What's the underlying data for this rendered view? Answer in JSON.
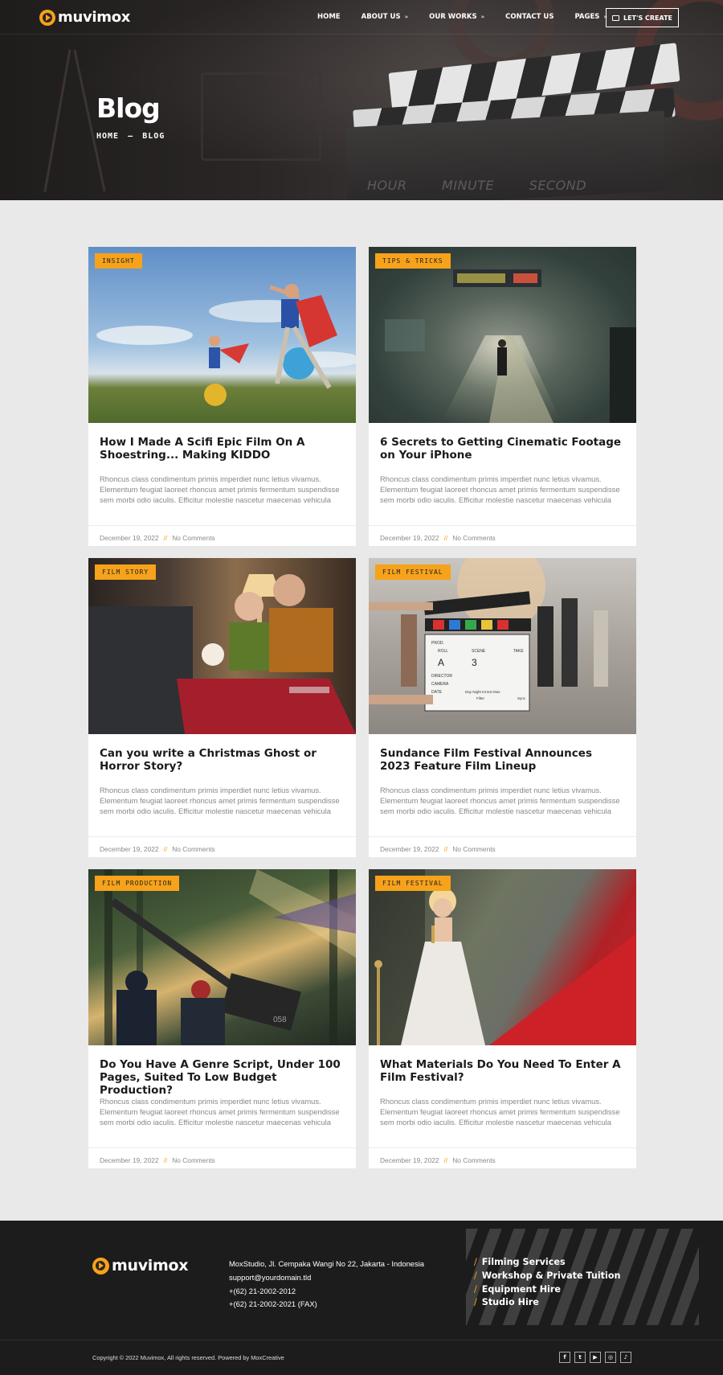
{
  "brand": {
    "name": "muvimox",
    "accent": "#f6a21b"
  },
  "nav": {
    "items": [
      {
        "label": "HOME",
        "has_dropdown": false
      },
      {
        "label": "ABOUT US",
        "has_dropdown": true
      },
      {
        "label": "OUR WORKS",
        "has_dropdown": true
      },
      {
        "label": "CONTACT US",
        "has_dropdown": false
      },
      {
        "label": "PAGES",
        "has_dropdown": true
      }
    ],
    "cta_label": "LET'S CREATE"
  },
  "hero": {
    "title": "Blog",
    "breadcrumb": [
      "HOME",
      "—",
      "BLOG"
    ],
    "slate_labels": [
      "HOUR",
      "MINUTE",
      "SECOND"
    ]
  },
  "posts": [
    {
      "tag": "INSIGHT",
      "title": "How I Made A Scifi Epic Film On A Shoestring... Making KIDDO",
      "excerpt": "Rhoncus class condimentum primis imperdiet nunc letius vivamus. Elementum feugiat laoreet rhoncus amet primis fermentum suspendisse sem morbi odio iaculis. Efficitur molestie nascetur maecenas vehicula",
      "date": "December 19, 2022",
      "comments": "No Comments",
      "sep": "//"
    },
    {
      "tag": "TIPS & TRICKS",
      "title": "6 Secrets to Getting Cinematic Footage on Your iPhone",
      "excerpt": "Rhoncus class condimentum primis imperdiet nunc letius vivamus. Elementum feugiat laoreet rhoncus amet primis fermentum suspendisse sem morbi odio iaculis. Efficitur molestie nascetur maecenas vehicula",
      "date": "December 19, 2022",
      "comments": "No Comments",
      "sep": "//"
    },
    {
      "tag": "FILM STORY",
      "title": "Can you write a Christmas Ghost or Horror Story?",
      "excerpt": "Rhoncus class condimentum primis imperdiet nunc letius vivamus. Elementum feugiat laoreet rhoncus amet primis fermentum suspendisse sem morbi odio iaculis. Efficitur molestie nascetur maecenas vehicula",
      "date": "December 19, 2022",
      "comments": "No Comments",
      "sep": "//"
    },
    {
      "tag": "FILM FESTIVAL",
      "title": "Sundance Film Festival Announces 2023 Feature Film Lineup",
      "excerpt": "Rhoncus class condimentum primis imperdiet nunc letius vivamus. Elementum feugiat laoreet rhoncus amet primis fermentum suspendisse sem morbi odio iaculis. Efficitur molestie nascetur maecenas vehicula",
      "date": "December 19, 2022",
      "comments": "No Comments",
      "sep": "//"
    },
    {
      "tag": "FILM PRODUCTION",
      "title": "Do You Have A Genre Script, Under 100 Pages, Suited To Low Budget Production?",
      "excerpt": "Rhoncus class condimentum primis imperdiet nunc letius vivamus. Elementum feugiat laoreet rhoncus amet primis fermentum suspendisse sem morbi odio iaculis. Efficitur molestie nascetur maecenas vehicula",
      "date": "December 19, 2022",
      "comments": "No Comments",
      "sep": "//"
    },
    {
      "tag": "FILM FESTIVAL",
      "title": "What Materials Do You Need To Enter A Film Festival?",
      "excerpt": "Rhoncus class condimentum primis imperdiet nunc letius vivamus. Elementum feugiat laoreet rhoncus amet primis fermentum suspendisse sem morbi odio iaculis. Efficitur molestie nascetur maecenas vehicula",
      "date": "December 19, 2022",
      "comments": "No Comments",
      "sep": "//"
    }
  ],
  "slate_card": {
    "prod": "PROD.",
    "roll": "ROLL",
    "scene": "SCENE",
    "take": "TAKE",
    "roll_val": "A",
    "scene_val": "3",
    "director": "DIRECTOR",
    "camera": "CAMERA",
    "date": "DATE",
    "day_night": "Day Night Int Ext Mos",
    "filter": "Filter",
    "sync": "Sync"
  },
  "train_number": "058",
  "footer": {
    "address": "MoxStudio, Jl. Cempaka Wangi No 22, Jakarta - Indonesia",
    "email": "support@yourdomain.tld",
    "phone": "+(62) 21-2002-2012",
    "fax": "+(62) 21-2002-2021 (FAX)",
    "links": [
      "Filming Services",
      "Workshop & Private Tuition",
      "Equipment Hire",
      "Studio Hire"
    ],
    "link_sep": "/",
    "copyright": "Copyright © 2022 Muvimox, All rights reserved. Powered by MoxCreative",
    "socials": [
      {
        "icon": "facebook-icon",
        "glyph": "f"
      },
      {
        "icon": "twitter-icon",
        "glyph": "t"
      },
      {
        "icon": "youtube-icon",
        "glyph": "▶"
      },
      {
        "icon": "instagram-icon",
        "glyph": "◎"
      },
      {
        "icon": "tiktok-icon",
        "glyph": "♪"
      }
    ]
  }
}
